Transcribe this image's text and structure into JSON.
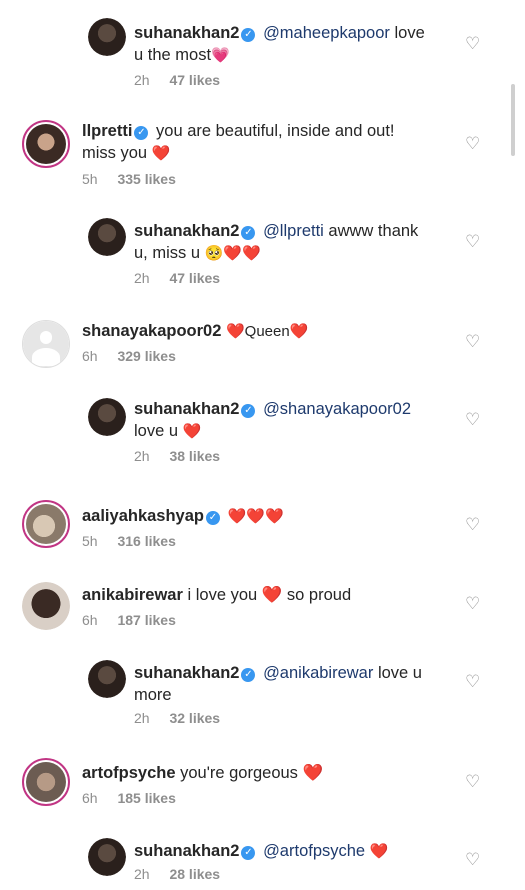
{
  "comments": [
    {
      "user": "suhanakhan2",
      "verified": true,
      "mention": "@maheepkapoor",
      "text": "love",
      "text2": "u the most",
      "emoji": "💗",
      "time": "2h",
      "likes": "47 likes",
      "reply": true
    },
    {
      "user": "llpretti",
      "verified": true,
      "mention": "",
      "text": "you are beautiful, inside and out!",
      "text2": "miss you",
      "emoji": "❤️",
      "time": "5h",
      "likes": "335 likes",
      "reply": false
    },
    {
      "user": "suhanakhan2",
      "verified": true,
      "mention": "@llpretti",
      "text": "awww thank",
      "text2": "u, miss u",
      "emoji": "🥺❤️❤️",
      "time": "2h",
      "likes": "47 likes",
      "reply": true
    },
    {
      "user": "shanayakapoor02",
      "verified": false,
      "mention": "",
      "text": "❤️Queen❤️",
      "text2": "",
      "emoji": "",
      "time": "6h",
      "likes": "329 likes",
      "reply": false
    },
    {
      "user": "suhanakhan2",
      "verified": true,
      "mention": "@shanayakapoor02",
      "text": "",
      "text2": "love u",
      "emoji": "❤️",
      "time": "2h",
      "likes": "38 likes",
      "reply": true
    },
    {
      "user": "aaliyahkashyap",
      "verified": true,
      "mention": "",
      "text": "❤️❤️❤️",
      "text2": "",
      "emoji": "",
      "time": "5h",
      "likes": "316 likes",
      "reply": false
    },
    {
      "user": "anikabirewar",
      "verified": false,
      "mention": "",
      "text": "i love you ❤️ so proud",
      "text2": "",
      "emoji": "",
      "time": "6h",
      "likes": "187 likes",
      "reply": false
    },
    {
      "user": "suhanakhan2",
      "verified": true,
      "mention": "@anikabirewar",
      "text": "love u",
      "text2": "more",
      "emoji": "",
      "time": "2h",
      "likes": "32 likes",
      "reply": true
    },
    {
      "user": "artofpsyche",
      "verified": false,
      "mention": "",
      "text": "you're gorgeous ❤️",
      "text2": "",
      "emoji": "",
      "time": "6h",
      "likes": "185 likes",
      "reply": false
    },
    {
      "user": "suhanakhan2",
      "verified": true,
      "mention": "@artofpsyche",
      "text": "❤️",
      "text2": "",
      "emoji": "",
      "time": "2h",
      "likes": "28 likes",
      "reply": true
    }
  ],
  "icons": {
    "verified": "verified-badge-icon",
    "like": "heart-outline-icon"
  }
}
